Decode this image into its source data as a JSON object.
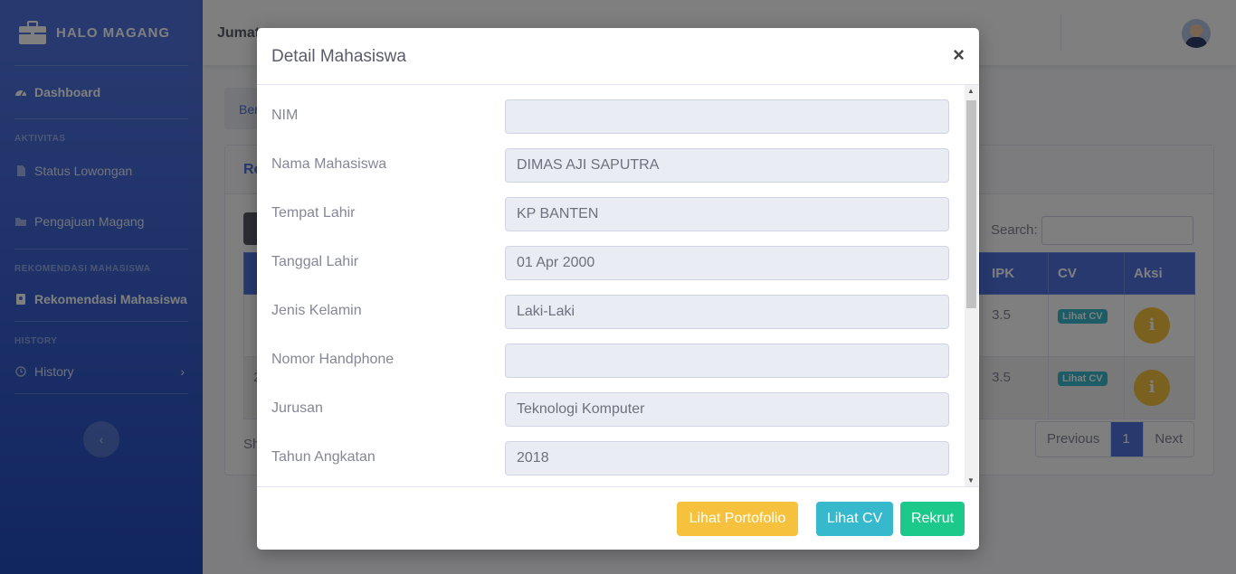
{
  "sidebar": {
    "brand": "HALO MAGANG",
    "dashboard": "Dashboard",
    "section_aktivitas": "AKTIVITAS",
    "status_lowongan": "Status Lowongan",
    "pengajuan_magang": "Pengajuan Magang",
    "section_rekomendasi": "REKOMENDASI MAHASISWA",
    "rekomendasi_mahasiswa": "Rekomendasi Mahasiswa",
    "section_history": "HISTORY",
    "history": "History",
    "toggle_icon": "chevron-left-icon"
  },
  "topbar": {
    "day": "Jumat",
    "user_icon": "user-avatar"
  },
  "background": {
    "breadcrumb": "Ber",
    "card_title": "Re",
    "search_label": "Search:",
    "columns": [
      "IPK",
      "CV",
      "Aksi"
    ],
    "rows": [
      {
        "ipk": "3.5",
        "cv": "Lihat CV",
        "aksi": "i"
      },
      {
        "ipk": "3.5",
        "cv": "Lihat CV",
        "aksi": "i"
      }
    ],
    "row2_prefix": "2",
    "showing_prefix": "Sh",
    "pagination": {
      "previous": "Previous",
      "page": "1",
      "next": "Next"
    }
  },
  "modal": {
    "title": "Detail Mahasiswa",
    "close": "×",
    "fields": [
      {
        "label": "NIM",
        "value": ""
      },
      {
        "label": "Nama Mahasiswa",
        "value": "DIMAS AJI SAPUTRA"
      },
      {
        "label": "Tempat Lahir",
        "value": "KP BANTEN"
      },
      {
        "label": "Tanggal Lahir",
        "value": "01 Apr 2000"
      },
      {
        "label": "Jenis Kelamin",
        "value": "Laki-Laki"
      },
      {
        "label": "Nomor Handphone",
        "value": ""
      },
      {
        "label": "Jurusan",
        "value": "Teknologi Komputer"
      },
      {
        "label": "Tahun Angkatan",
        "value": "2018"
      }
    ],
    "buttons": {
      "portofolio": "Lihat Portofolio",
      "cv": "Lihat CV",
      "rekrut": "Rekrut"
    }
  },
  "colors": {
    "primary": "#4e73df",
    "warning": "#f6c23e",
    "info": "#36b9cc",
    "success": "#1cc88a"
  }
}
